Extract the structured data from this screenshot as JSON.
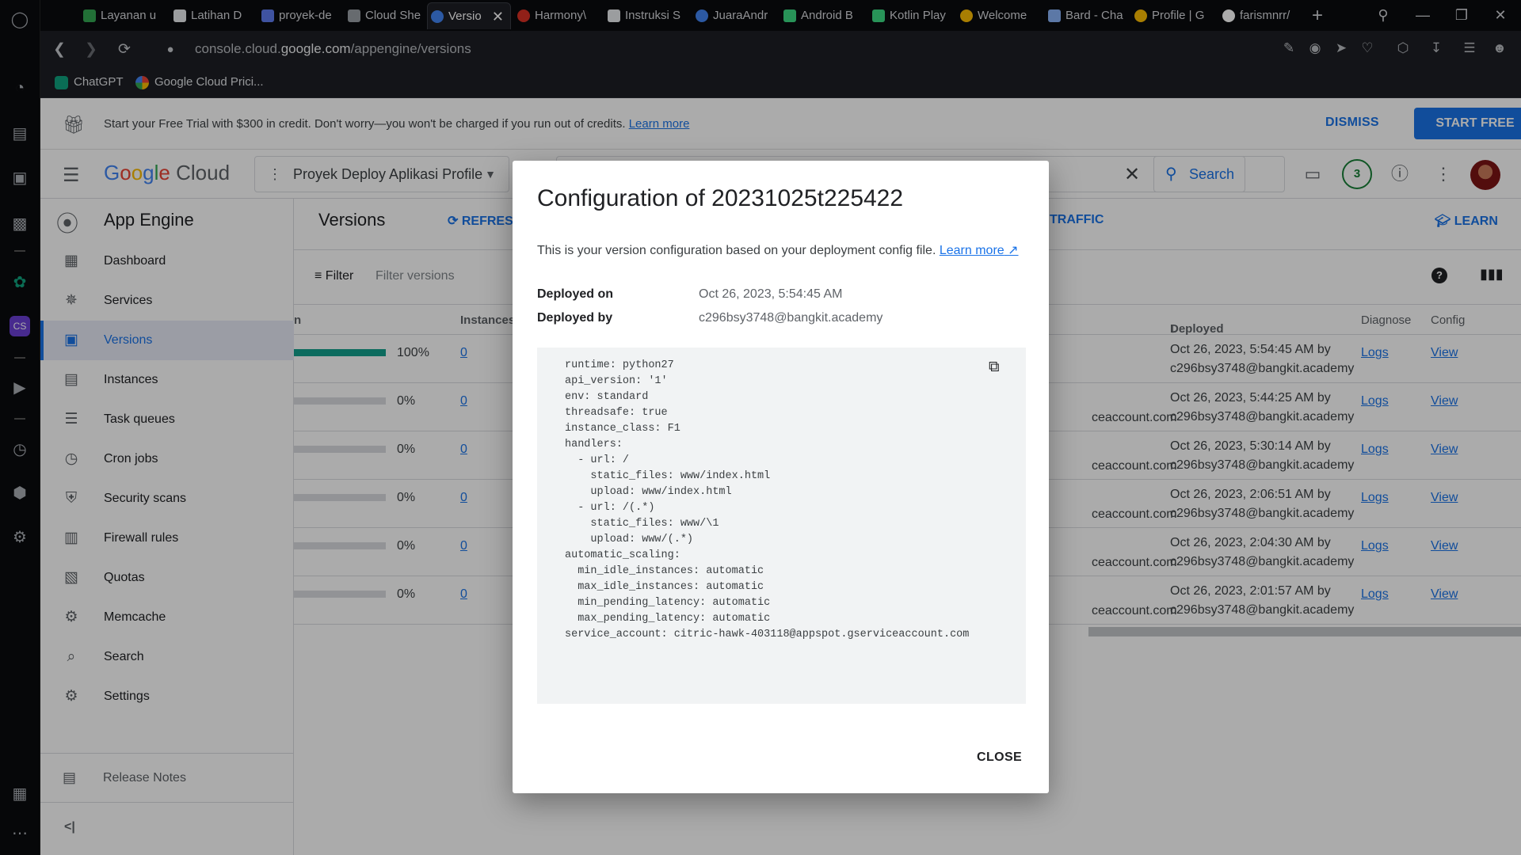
{
  "browser": {
    "tabs": [
      {
        "label": "Layanan u",
        "color": "#34a853"
      },
      {
        "label": "Latihan D",
        "color": "#e8eaed"
      },
      {
        "label": "proyek-de",
        "color": "#5f7cf0"
      },
      {
        "label": "Cloud She",
        "color": "#9aa0a6"
      },
      {
        "label": "Versio",
        "color": "#4285f4",
        "active": true
      },
      {
        "label": "Harmony\\",
        "color": "#d93025"
      },
      {
        "label": "Instruksi S",
        "color": "#e8eaed"
      },
      {
        "label": "JuaraAndr",
        "color": "#4285f4"
      },
      {
        "label": "Android B",
        "color": "#3ddc84"
      },
      {
        "label": "Kotlin Play",
        "color": "#3ddc84"
      },
      {
        "label": "Welcome",
        "color": "#fbbc04"
      },
      {
        "label": "Bard - Cha",
        "color": "#8ab4f8"
      },
      {
        "label": "Profile | G",
        "color": "#fbbc04"
      },
      {
        "label": "farismnrr/",
        "color": "#ffffff"
      }
    ],
    "url_prefix": "console.cloud.",
    "url_host": "google.com",
    "url_path": "/appengine/versions",
    "bookmarks": [
      {
        "label": "ChatGPT",
        "color": "#10a37f"
      },
      {
        "label": "Google Cloud Prici...",
        "color": "#ea4335"
      }
    ]
  },
  "trial_banner": {
    "message": "Start your Free Trial with $300 in credit. Don't worry—you won't be charged if you run out of credits.",
    "learn_more": "Learn more",
    "dismiss": "DISMISS",
    "start_free": "START FREE"
  },
  "header": {
    "logo_google": [
      "G",
      "o",
      "o",
      "g",
      "l",
      "e"
    ],
    "logo_cloud": "Cloud",
    "project": "Proyek Deploy Aplikasi Profile",
    "search_button": "Search",
    "notifications": "3"
  },
  "sidebar": {
    "product": "App Engine",
    "items": [
      {
        "label": "Dashboard",
        "icon": "dashboard-icon",
        "glyph": "▦"
      },
      {
        "label": "Services",
        "icon": "services-icon",
        "glyph": "✵"
      },
      {
        "label": "Versions",
        "icon": "versions-icon",
        "glyph": "▣",
        "selected": true
      },
      {
        "label": "Instances",
        "icon": "instances-icon",
        "glyph": "▤"
      },
      {
        "label": "Task queues",
        "icon": "task-queues-icon",
        "glyph": "☰"
      },
      {
        "label": "Cron jobs",
        "icon": "cron-jobs-icon",
        "glyph": "◷"
      },
      {
        "label": "Security scans",
        "icon": "security-scans-icon",
        "glyph": "⛨"
      },
      {
        "label": "Firewall rules",
        "icon": "firewall-rules-icon",
        "glyph": "▥"
      },
      {
        "label": "Quotas",
        "icon": "quotas-icon",
        "glyph": "▧"
      },
      {
        "label": "Memcache",
        "icon": "memcache-icon",
        "glyph": "⚙"
      },
      {
        "label": "Search",
        "icon": "search-icon",
        "glyph": "⌕"
      },
      {
        "label": "Settings",
        "icon": "settings-icon",
        "glyph": "⚙"
      }
    ],
    "release_notes": "Release Notes",
    "collapse": "<|"
  },
  "main": {
    "title": "Versions",
    "refresh": "REFRES",
    "traffic": "TRAFFIC",
    "learn": "LEARN",
    "filter_label": "Filter",
    "filter_placeholder": "Filter versions",
    "headers": {
      "partial": "n",
      "instances": "Instances",
      "deployed": "Deployed",
      "diagnose": "Diagnose",
      "config": "Config"
    },
    "rows": [
      {
        "traffic": 1.0,
        "pct": "100%",
        "instances": "0",
        "account": "",
        "deployed_date": "Oct 26, 2023, 5:54:45 AM by",
        "deployed_by": "c296bsy3748@bangkit.academy",
        "logs": "Logs",
        "view": "View"
      },
      {
        "traffic": 0.0,
        "pct": "0%",
        "instances": "0",
        "account": "ceaccount.com",
        "deployed_date": "Oct 26, 2023, 5:44:25 AM by",
        "deployed_by": "c296bsy3748@bangkit.academy",
        "logs": "Logs",
        "view": "View"
      },
      {
        "traffic": 0.0,
        "pct": "0%",
        "instances": "0",
        "account": "ceaccount.com",
        "deployed_date": "Oct 26, 2023, 5:30:14 AM by",
        "deployed_by": "c296bsy3748@bangkit.academy",
        "logs": "Logs",
        "view": "View"
      },
      {
        "traffic": 0.0,
        "pct": "0%",
        "instances": "0",
        "account": "ceaccount.com",
        "deployed_date": "Oct 26, 2023, 2:06:51 AM by",
        "deployed_by": "c296bsy3748@bangkit.academy",
        "logs": "Logs",
        "view": "View"
      },
      {
        "traffic": 0.0,
        "pct": "0%",
        "instances": "0",
        "account": "ceaccount.com",
        "deployed_date": "Oct 26, 2023, 2:04:30 AM by",
        "deployed_by": "c296bsy3748@bangkit.academy",
        "logs": "Logs",
        "view": "View"
      },
      {
        "traffic": 0.0,
        "pct": "0%",
        "instances": "0",
        "account": "ceaccount.com",
        "deployed_date": "Oct 26, 2023, 2:01:57 AM by",
        "deployed_by": "c296bsy3748@bangkit.academy",
        "logs": "Logs",
        "view": "View"
      }
    ]
  },
  "dialog": {
    "title": "Configuration of 20231025t225422",
    "description": "This is your version configuration based on your deployment config file.",
    "learn_more": "Learn more",
    "deployed_on_label": "Deployed on",
    "deployed_on": "Oct 26, 2023, 5:54:45 AM",
    "deployed_by_label": "Deployed by",
    "deployed_by": "c296bsy3748@bangkit.academy",
    "config": "runtime: python27\napi_version: '1'\nenv: standard\nthreadsafe: true\ninstance_class: F1\nhandlers:\n  - url: /\n    static_files: www/index.html\n    upload: www/index.html\n  - url: /(.*)\n    static_files: www/\\1\n    upload: www/(.*)\nautomatic_scaling:\n  min_idle_instances: automatic\n  max_idle_instances: automatic\n  min_pending_latency: automatic\n  max_pending_latency: automatic\nservice_account: citric-hawk-403118@appspot.gserviceaccount.com",
    "close": "CLOSE"
  }
}
